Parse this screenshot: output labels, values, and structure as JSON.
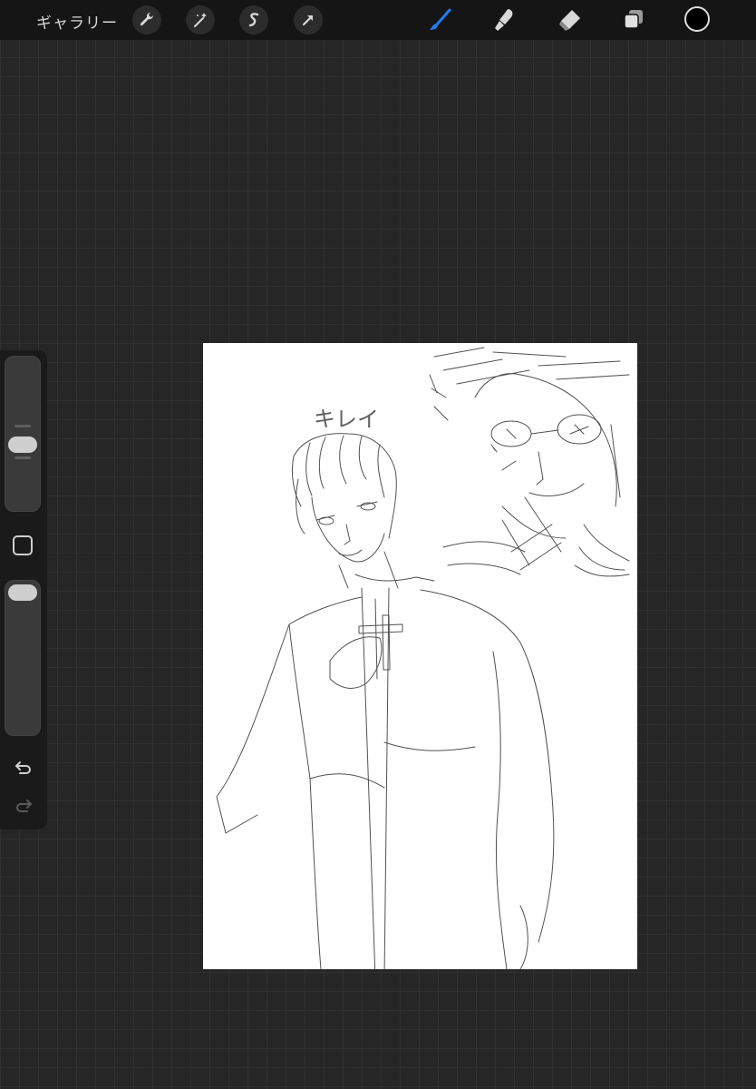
{
  "app": {
    "gallery_label": "ギャラリー"
  },
  "toolbar": {
    "left_tools": [
      "wrench-icon",
      "magic-wand-icon",
      "selection-icon",
      "transform-arrow-icon"
    ],
    "right_tools": [
      "brush-icon",
      "smudge-icon",
      "eraser-icon",
      "layers-icon"
    ],
    "active_tool": "brush",
    "accent_color": "#1e7cf2",
    "current_color": "#000000"
  },
  "sidebar": {
    "brush_size_icon": "brush-size-slider",
    "opacity_icon": "opacity-slider",
    "modify_icon": "square-modify-icon",
    "undo_icon": "undo-icon",
    "redo_icon": "redo-icon"
  },
  "canvas": {
    "artwork_text": "キレイ",
    "background": "#ffffff"
  }
}
